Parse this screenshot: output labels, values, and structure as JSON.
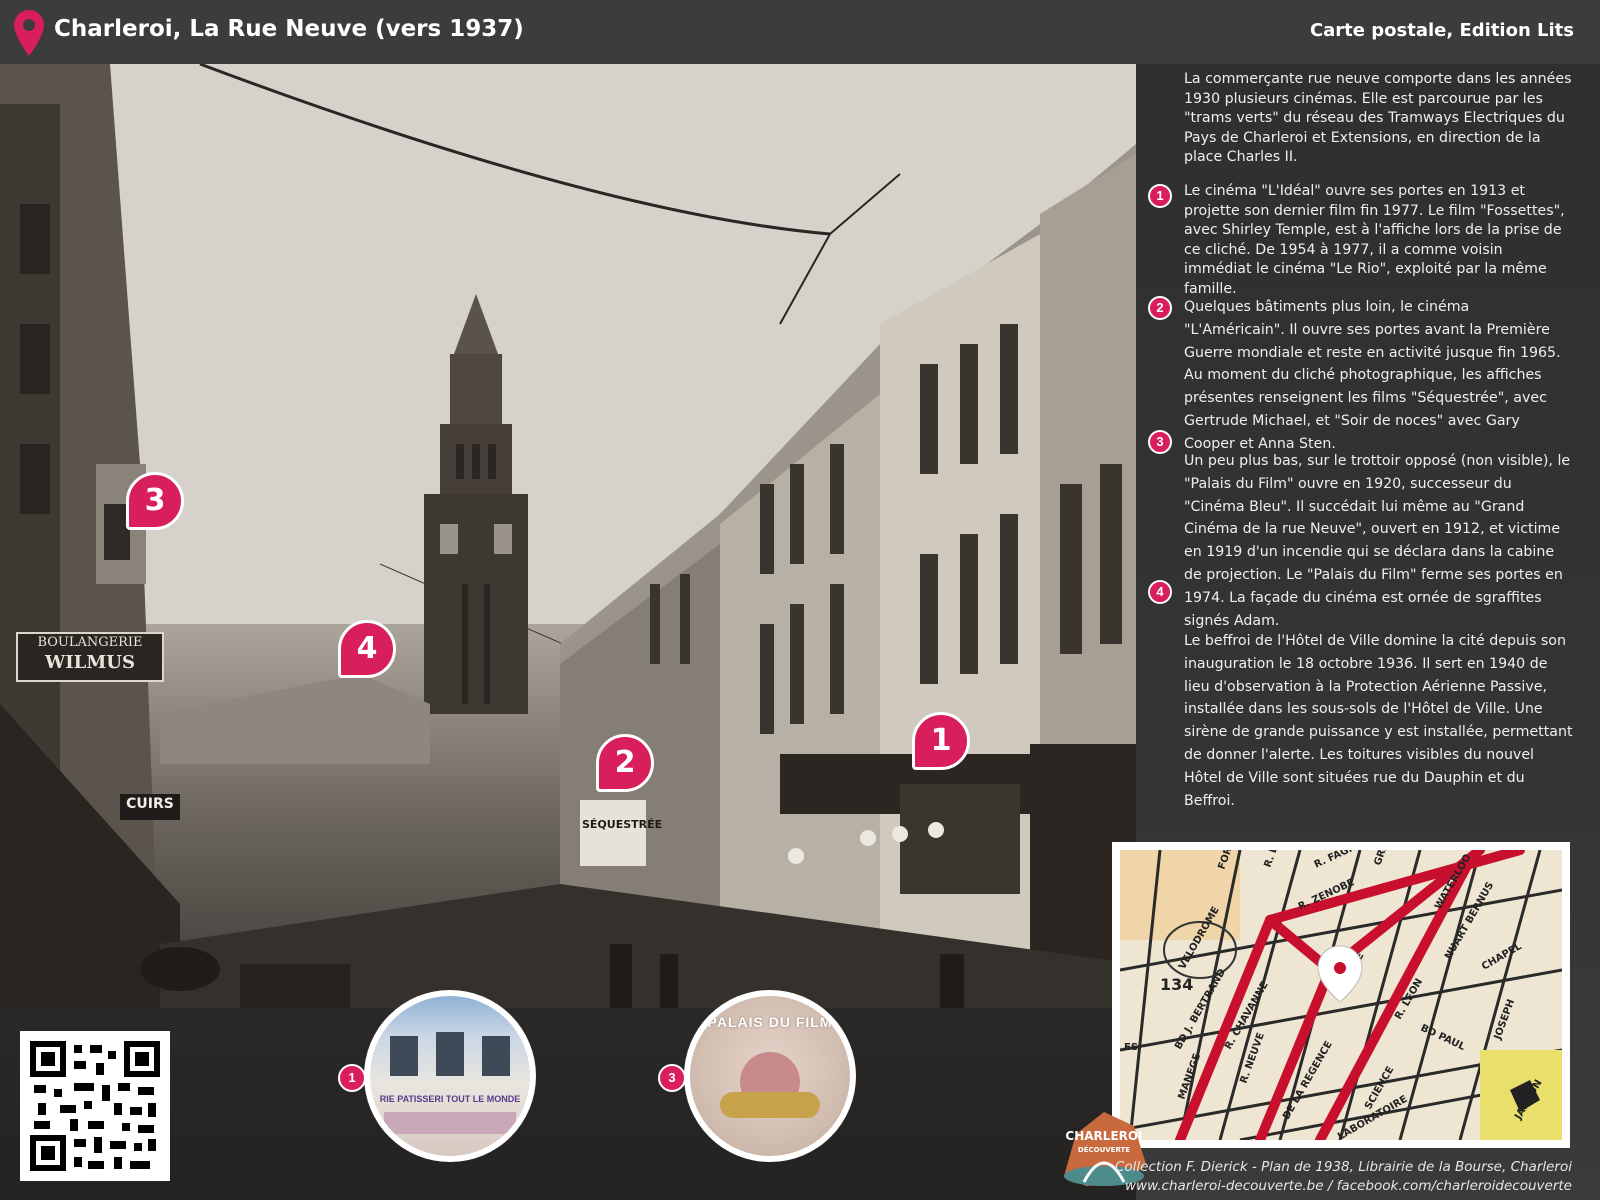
{
  "header": {
    "title": "Charleroi, La Rue Neuve (vers 1937)",
    "source": "Carte postale, Edition Lits"
  },
  "photo": {
    "signs": {
      "bakery_line1": "BOULANGERIE",
      "bakery_line2": "WILMUS",
      "cuirs": "CUIRS",
      "sequestree": "SÉQUESTRÉE"
    },
    "markers": [
      {
        "number": "1"
      },
      {
        "number": "2"
      },
      {
        "number": "3"
      },
      {
        "number": "4"
      }
    ]
  },
  "panel": {
    "intro": "La commerçante rue neuve comporte dans les années 1930 plusieurs cinémas. Elle est parcourue par les \"trams verts\" du réseau des Tramways Electriques du Pays de Charleroi et Extensions, en direction de la place Charles II.",
    "items": [
      {
        "number": "1",
        "text": "Le cinéma \"L'Idéal\" ouvre ses portes en 1913 et projette son dernier film fin 1977. Le film \"Fossettes\", avec Shirley Temple, est à l'affiche lors de la prise de ce cliché. De 1954 à 1977, il a comme voisin immédiat le cinéma \"Le Rio\", exploité par la même famille."
      },
      {
        "number": "2",
        "text": "Quelques bâtiments plus loin, le cinéma \"L'Américain\". Il ouvre ses portes avant la Première Guerre mondiale et reste en activité jusque fin 1965. Au moment du cliché photographique, les affiches présentes renseignent les films \"Séquestrée\", avec Gertrude Michael, et \"Soir de noces\" avec Gary Cooper et Anna Sten."
      },
      {
        "number": "3",
        "text": "Un peu plus bas, sur le trottoir opposé (non visible), le \"Palais du Film\" ouvre en 1920, successeur du \"Cinéma Bleu\". Il succédait lui même au \"Grand Cinéma de la rue Neuve\", ouvert en 1912, et victime en 1919 d'un incendie qui se déclara dans la cabine de projection. Le \"Palais du Film\" ferme ses portes en 1974. La façade du cinéma est ornée de sgraffites signés Adam."
      },
      {
        "number": "4",
        "text": "Le beffroi de l'Hôtel de Ville domine la cité depuis son inauguration le 18 octobre 1936. Il sert en 1940 de lieu d'observation à la Protection Aérienne Passive, installée dans les sous-sols de l'Hôtel de Ville. Une sirène de grande puissance y est installée, permettant de donner l'alerte. Les toitures visibles du nouvel Hôtel de Ville sont situées rue du Dauphin et du Beffroi."
      }
    ]
  },
  "thumbnails": [
    {
      "number": "1",
      "caption": "RIE PATISSERI TOUT LE MONDE"
    },
    {
      "number": "3",
      "caption": "PALAIS DU FILM"
    }
  ],
  "map": {
    "labels": [
      "FORT",
      "R. DU",
      "R. FAGN",
      "GRAMM",
      "R. ZENOBE",
      "WATERLOO",
      "VELODROME",
      "134",
      "BD J. BERTRAND",
      "R. CHAVANNE",
      "AV. DE",
      "NUART BERNUS",
      "CHAPEL",
      "R. LEON",
      "BD PAUL",
      "R. NEUVE",
      "MANEGE",
      "DE LA REGENCE",
      "SCIENCE",
      "LABORATOIRE",
      "JOSEPH",
      "JANSON",
      "ES"
    ]
  },
  "logo": {
    "line1": "CHARLEROI",
    "line2": "DÉCOUVERTE"
  },
  "credits": {
    "line1": "Collection F. Dierick - Plan de 1938, Librairie de la Bourse, Charleroi",
    "line2": "www.charleroi-decouverte.be  /  facebook.com/charleroidecouverte"
  },
  "colors": {
    "accent": "#d81e5b",
    "header_bg": "#3c3c3e",
    "map_road": "#c8102e"
  },
  "icons": {
    "header": "map-pin-icon",
    "map": "map-pin-icon"
  }
}
